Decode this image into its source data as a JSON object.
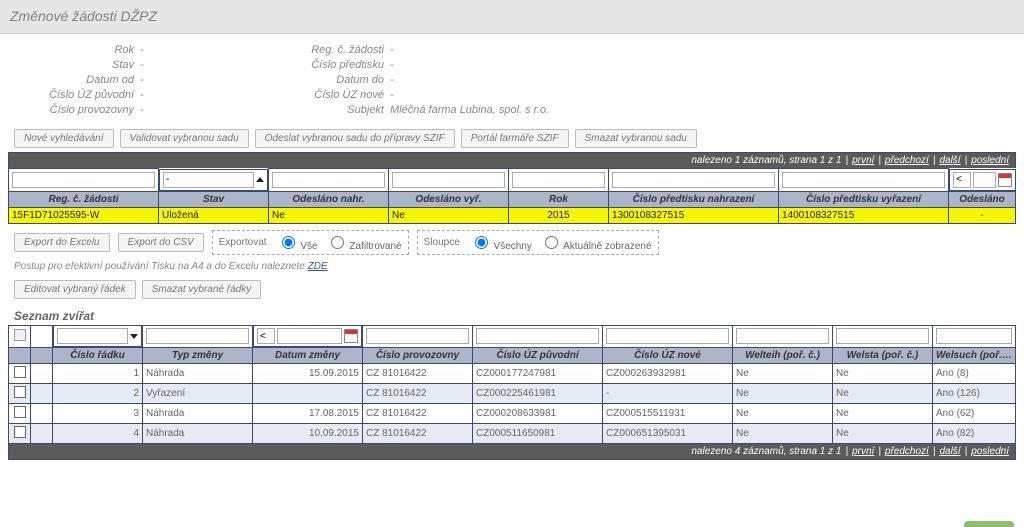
{
  "title": "Změnové žádosti DŽPZ",
  "details": {
    "rok_l": "Rok",
    "rok_v": "-",
    "reg_l": "Reg. č. žádosti",
    "reg_v": "-",
    "stav_l": "Stav",
    "stav_v": "-",
    "cpredt_l": "Číslo předtisku",
    "cpredt_v": "-",
    "dod_l": "Datum od",
    "dod_v": "-",
    "ddo_l": "Datum do",
    "ddo_v": "-",
    "cuzp_l": "Číslo ÚZ původní",
    "cuzp_v": "-",
    "cuzn_l": "Číslo ÚZ nové",
    "cuzn_v": "-",
    "cprov_l": "Číslo provozovny",
    "cprov_v": "-",
    "subj_l": "Subjekt",
    "subj_v": "Mléčná farma Lubina, spol. s r.o."
  },
  "buttons": {
    "nove": "Nové vyhledávání",
    "validovat": "Validovat vybranou sadu",
    "odeslat": "Odeslat vybranou sadu do přípravy SZIF",
    "portal": "Portál farmáře SZIF",
    "smazat": "Smazat vybranou sadu",
    "edit": "Editovat vybraný řádek",
    "smazat_r": "Smazat vybrané řádky",
    "expE": "Export do Excelu",
    "expC": "Export do CSV"
  },
  "note": {
    "t1": "Postup pro efektivní používání Tisku na A4 a do Excelu naleznete ",
    "link": "ZDE"
  },
  "fieldsets": {
    "export_lbl": "Exportovat",
    "export_o1": "Vše",
    "export_o2": "Zafiltrované",
    "cols_lbl": "Sloupce",
    "cols_o1": "Všechny",
    "cols_o2": "Aktuálně zobrazené"
  },
  "pager1": {
    "found": "nalezeno 1 záznamů, strana 1 z 1",
    "first": "první",
    "prev": "předchozí",
    "next": "další",
    "last": "poslední"
  },
  "pager2": {
    "found": "nalezeno 4 záznamů, strana 1 z 1",
    "first": "první",
    "prev": "předchozí",
    "next": "další",
    "last": "poslední"
  },
  "grid1": {
    "h": [
      "Reg. č. žádosti",
      "Stav",
      "Odesláno nahr.",
      "Odesláno vyř.",
      "Rok",
      "Číslo předtisku nahrazení",
      "Číslo předtisku vyřazení",
      "Odesláno"
    ],
    "row": [
      "15F1D71025595-W",
      "Uložená",
      "Ne",
      "Ne",
      "2015",
      "1300108327515",
      "1400108327515",
      "-"
    ]
  },
  "section2": "Seznam zvířat",
  "grid2": {
    "h": [
      "",
      "",
      "Číslo řádku",
      "Typ změny",
      "Datum změny",
      "Číslo provozovny",
      "Číslo ÚZ původní",
      "Číslo ÚZ nové",
      "Welteih (poř. č.)",
      "Welsta (poř. č.)",
      "Welsuch (poř. č.)"
    ],
    "rows": [
      [
        "",
        "",
        "1",
        "Náhrada",
        "15.09.2015",
        "CZ 81016422",
        "CZ000177247981",
        "CZ000263932981",
        "Ne",
        "Ne",
        "Ano (8)"
      ],
      [
        "",
        "",
        "2",
        "Vyřazení",
        "",
        "CZ 81016422",
        "CZ000225461981",
        "-",
        "Ne",
        "Ne",
        "Ano (126)"
      ],
      [
        "",
        "",
        "3",
        "Náhrada",
        "17.08.2015",
        "CZ 81016422",
        "CZ000208633981",
        "CZ000515511931",
        "Ne",
        "Ne",
        "Ano (62)"
      ],
      [
        "",
        "",
        "4",
        "Náhrada",
        "10.09.2015",
        "CZ 81016422",
        "CZ000511650981",
        "CZ000651395031",
        "Ne",
        "Ne",
        "Ano (82)"
      ]
    ]
  }
}
